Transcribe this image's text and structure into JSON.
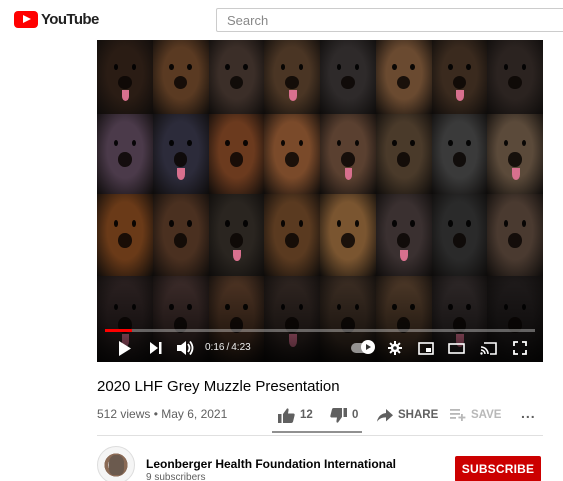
{
  "header": {
    "logo_text": "YouTube",
    "search_placeholder": "Search"
  },
  "player": {
    "progress_fraction": 0.063,
    "time_current": "0:16",
    "time_separator": "/",
    "time_total": "4:23",
    "tile_colors": [
      "#2a1c14",
      "#5a3a22",
      "#3b2e28",
      "#4a3524",
      "#2e2a2a",
      "#6a4a30",
      "#3a2a1e",
      "#2b2320",
      "#4b3a4a",
      "#2c2b3a",
      "#6b3a1e",
      "#7a4a2a",
      "#5a4030",
      "#4a3a2a",
      "#3a3a3a",
      "#5b4a3a",
      "#6a3a18",
      "#4a3020",
      "#2a2520",
      "#5a3a20",
      "#7a5530",
      "#3a3030",
      "#2a2a2a",
      "#4a3a30",
      "#2a2020",
      "#3a2a28",
      "#4b3222",
      "#2e2420",
      "#3a2c22",
      "#4a3626",
      "#2c2626",
      "#1e1a1a"
    ],
    "accent_color": "#ff0000"
  },
  "video": {
    "title": "2020 LHF Grey Muzzle Presentation",
    "views_date": "512 views • May 6, 2021"
  },
  "actions": {
    "like_count": "12",
    "dislike_count": "0",
    "share_label": "SHARE",
    "save_label": "SAVE",
    "more_label": "..."
  },
  "channel": {
    "name": "Leonberger Health Foundation International",
    "subscribers": "9 subscribers",
    "subscribe_label": "SUBSCRIBE"
  }
}
